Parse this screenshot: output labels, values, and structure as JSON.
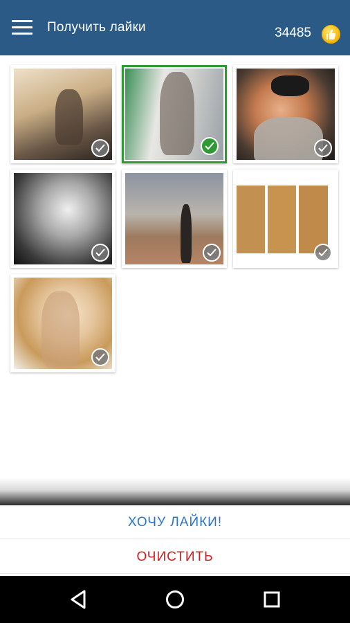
{
  "appbar": {
    "menu_icon": "hamburger-menu-icon",
    "title": "Получить лайки",
    "coins": "34485",
    "coin_icon": "coin-like-icon"
  },
  "photos": [
    {
      "name": "photo-1",
      "selected": false
    },
    {
      "name": "photo-2",
      "selected": true
    },
    {
      "name": "photo-3",
      "selected": false
    },
    {
      "name": "photo-4",
      "selected": false
    },
    {
      "name": "photo-5",
      "selected": false
    },
    {
      "name": "photo-6",
      "selected": false
    },
    {
      "name": "photo-7",
      "selected": false
    }
  ],
  "actions": {
    "want_likes": "ХОЧУ ЛАЙКИ!",
    "clear": "ОЧИСТИТЬ"
  },
  "colors": {
    "appbar": "#2b5a86",
    "selected_border": "#2f9a34",
    "want_likes_text": "#2a74c9",
    "clear_text": "#d11d1d"
  },
  "navbar": {
    "back_icon": "back-triangle-icon",
    "home_icon": "home-circle-icon",
    "recents_icon": "recents-square-icon"
  }
}
